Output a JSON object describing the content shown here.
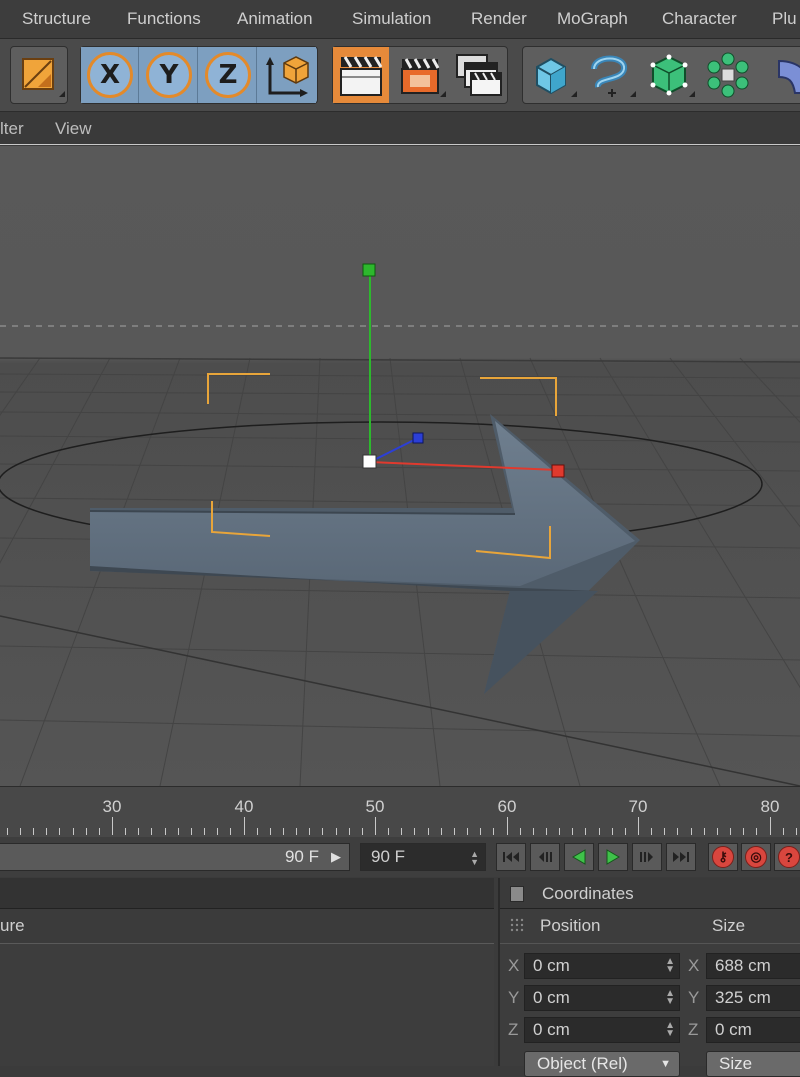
{
  "menu": {
    "items": [
      "Structure",
      "Functions",
      "Animation",
      "Simulation",
      "Render",
      "MoGraph",
      "Character",
      "Plu"
    ]
  },
  "toolbar": {
    "axis_x": "X",
    "axis_y": "Y",
    "axis_z": "Z"
  },
  "submenu": {
    "filter": "lter",
    "view": "View"
  },
  "timeline": {
    "labels": [
      "30",
      "40",
      "50",
      "60",
      "70",
      "80"
    ]
  },
  "transport": {
    "end_frame": "90 F",
    "max_frame": "90 F"
  },
  "object_panel": {
    "header_partial": "ure"
  },
  "coordinates": {
    "title": "Coordinates",
    "position_label": "Position",
    "size_label": "Size",
    "axis_x": "X",
    "axis_y": "Y",
    "axis_z": "Z",
    "pos_x": "0 cm",
    "pos_y": "0 cm",
    "pos_z": "0 cm",
    "size_x": "688 cm",
    "size_y": "325 cm",
    "size_z": "0 cm",
    "mode_select": "Object (Rel)",
    "size_select": "Size"
  },
  "colors": {
    "accent_orange": "#e68a3a",
    "axis_blue": "#7d9fc0",
    "y_axis": "#2db82d",
    "x_axis": "#e03a2e",
    "z_axis": "#2c3fd6",
    "selection": "#e8a53a"
  }
}
